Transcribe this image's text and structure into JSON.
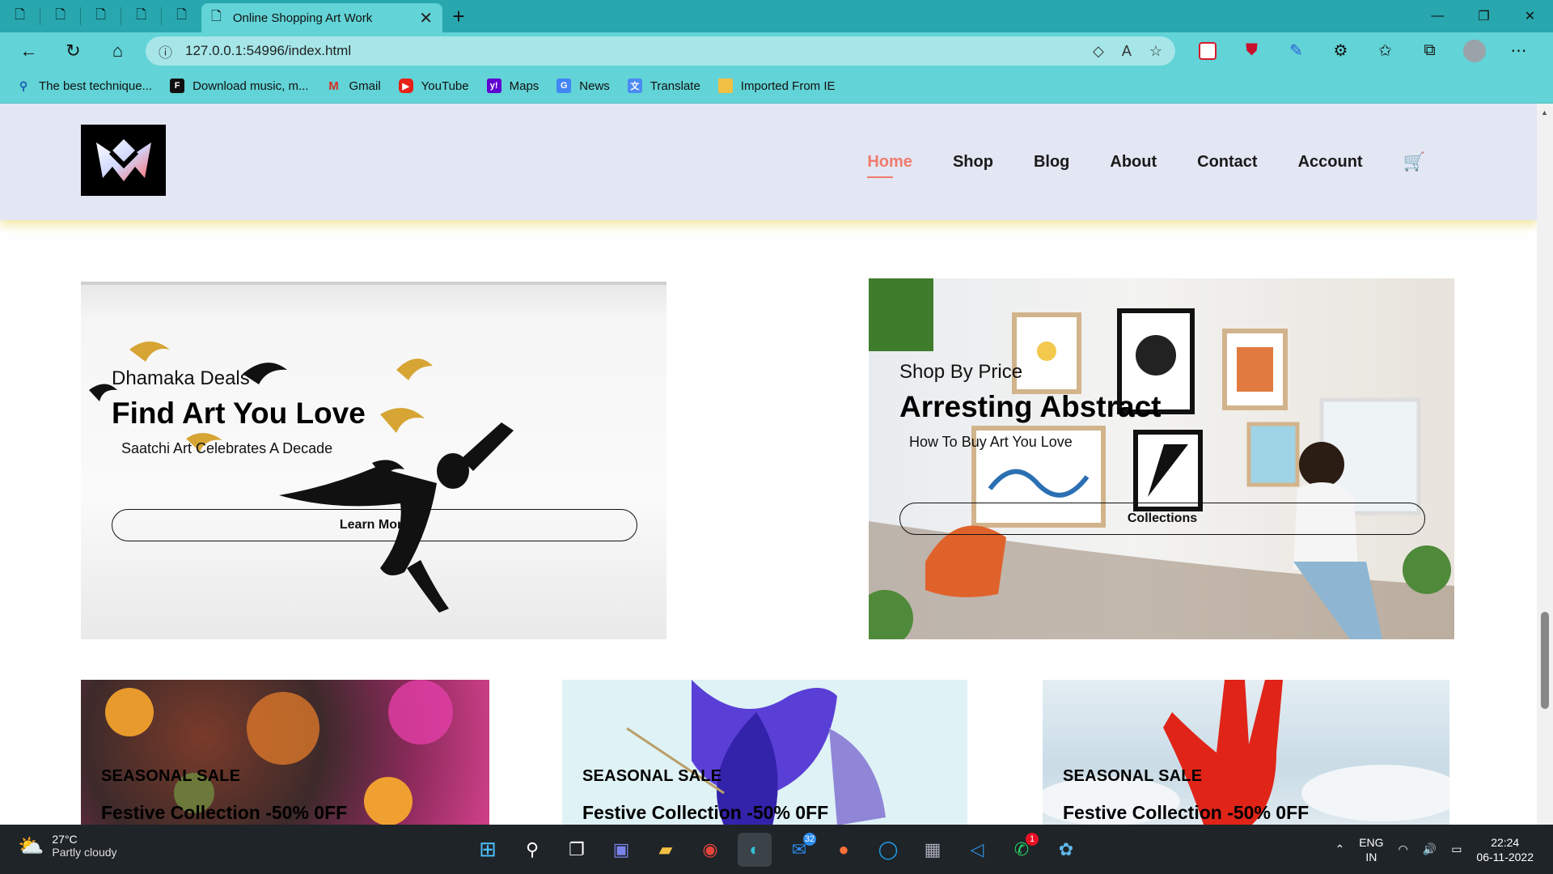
{
  "browser": {
    "tab_title": "Online Shopping Art Work",
    "url": "127.0.0.1:54996/index.html",
    "bookmarks": [
      {
        "label": "The best technique...",
        "icon": "search-icon"
      },
      {
        "label": "Download music, m...",
        "icon": "f-logo-icon"
      },
      {
        "label": "Gmail",
        "icon": "gmail-icon"
      },
      {
        "label": "YouTube",
        "icon": "youtube-icon"
      },
      {
        "label": "Maps",
        "icon": "yahoo-icon"
      },
      {
        "label": "News",
        "icon": "google-news-icon"
      },
      {
        "label": "Translate",
        "icon": "translate-icon"
      },
      {
        "label": "Imported From IE",
        "icon": "folder-icon"
      }
    ]
  },
  "site": {
    "nav": [
      "Home",
      "Shop",
      "Blog",
      "About",
      "Contact",
      "Account"
    ],
    "active_nav": "Home",
    "accent_color": "#f07c6d",
    "header_bg": "#e3e6f3"
  },
  "banners": [
    {
      "eyebrow": "Dhamaka Deals",
      "headline": "Find Art You Love",
      "sub": "Saatchi Art Celebrates A Decade",
      "button": "Learn More"
    },
    {
      "eyebrow": "Shop By Price",
      "headline": "Arresting Abstract",
      "sub": "How To Buy Art You Love",
      "button": "Collections"
    }
  ],
  "cards": [
    {
      "label": "SEASONAL SALE",
      "title": "Festive Collection -50% 0FF"
    },
    {
      "label": "SEASONAL SALE",
      "title": "Festive Collection -50% 0FF"
    },
    {
      "label": "SEASONAL SALE",
      "title": "Festive Collection -50% 0FF"
    }
  ],
  "taskbar": {
    "temperature": "27°C",
    "condition": "Partly cloudy",
    "mail_badge": "32",
    "whatsapp_badge": "1",
    "lang_top": "ENG",
    "lang_bottom": "IN",
    "time": "22:24",
    "date": "06-11-2022"
  }
}
